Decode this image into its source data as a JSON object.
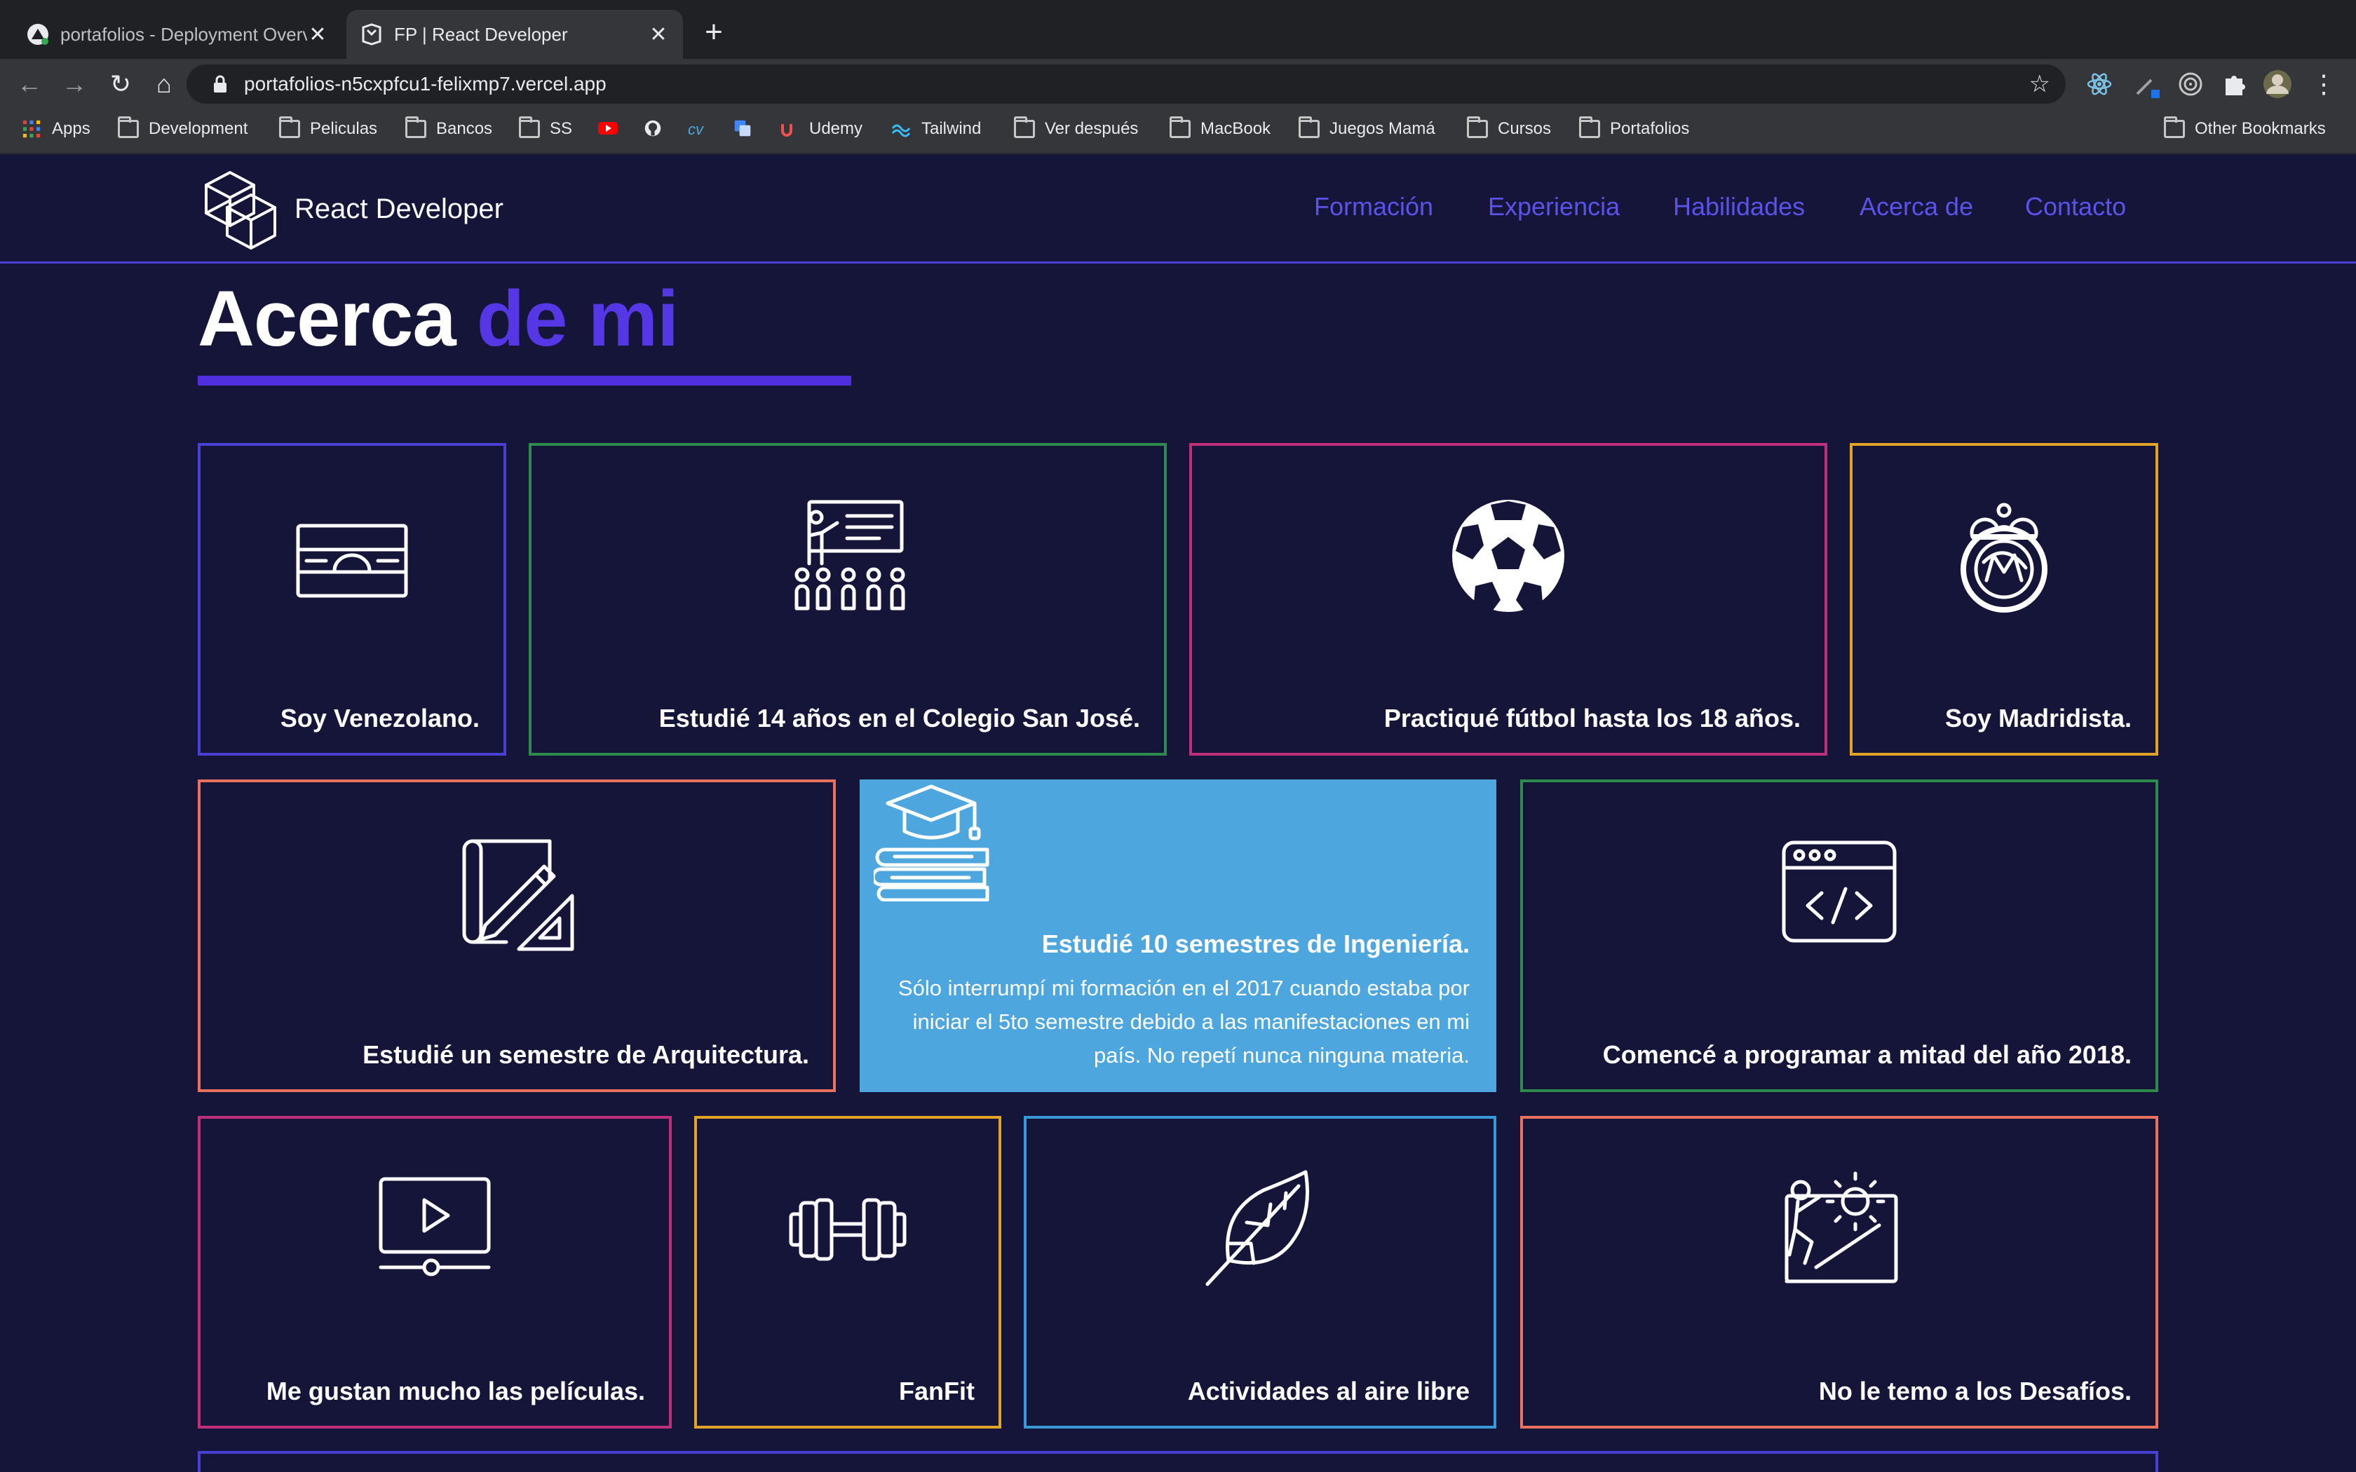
{
  "browser": {
    "tabs": [
      {
        "title": "portafolios - Deployment Overv"
      },
      {
        "title": "FP | React Developer"
      }
    ],
    "url": "portafolios-n5cxpfcu1-felixmp7.vercel.app",
    "bookmarks": [
      {
        "label": "Apps",
        "icon": "apps-grid-icon"
      },
      {
        "label": "Development",
        "icon": "folder-icon"
      },
      {
        "label": "Peliculas",
        "icon": "folder-icon"
      },
      {
        "label": "Bancos",
        "icon": "folder-icon"
      },
      {
        "label": "SS",
        "icon": "folder-icon"
      },
      {
        "label": "",
        "icon": "youtube-icon"
      },
      {
        "label": "",
        "icon": "github-icon"
      },
      {
        "label": "",
        "icon": "cv-icon"
      },
      {
        "label": "",
        "icon": "translate-icon"
      },
      {
        "label": "Udemy",
        "icon": "udemy-icon"
      },
      {
        "label": "Tailwind",
        "icon": "tailwind-icon"
      },
      {
        "label": "Ver después",
        "icon": "folder-icon"
      },
      {
        "label": "MacBook",
        "icon": "folder-icon"
      },
      {
        "label": "Juegos Mamá",
        "icon": "folder-icon"
      },
      {
        "label": "Cursos",
        "icon": "folder-icon"
      },
      {
        "label": "Portafolios",
        "icon": "folder-icon"
      }
    ],
    "other_bookmarks": "Other Bookmarks"
  },
  "site": {
    "brand": "React Developer",
    "nav": [
      "Formación",
      "Experiencia",
      "Habilidades",
      "Acerca de",
      "Contacto"
    ],
    "heading_main": "Acerca",
    "heading_accent": "de mi",
    "accent_color": "#5637e6"
  },
  "cards": {
    "venezuela": {
      "label": "Soy Venezolano.",
      "border": "#4a3fd4",
      "icon": "flag-icon"
    },
    "colegio": {
      "label": "Estudié 14 años en el Colegio San José.",
      "border": "#2f8a4e",
      "icon": "classroom-icon"
    },
    "futbol": {
      "label": "Practiqué fútbol hasta los 18 años.",
      "border": "#c0307a",
      "icon": "soccer-ball-icon"
    },
    "madrid": {
      "label": "Soy Madridista.",
      "border": "#e2a427",
      "icon": "real-madrid-crest-icon"
    },
    "arquitectura": {
      "label": "Estudié un semestre de Arquitectura.",
      "border": "#e8725e",
      "icon": "blueprint-icon"
    },
    "ingenieria": {
      "title": "Estudié 10 semestres de Ingeniería.",
      "description": "Sólo interrumpí mi formación en el 2017 cuando estaba por iniciar el 5to semestre debido a las manifestaciones en mi país. No repetí nunca ninguna materia.",
      "background": "#4ea6de",
      "icon": "graduation-books-icon"
    },
    "programar": {
      "label": "Comencé a programar a mitad del año 2018.",
      "border": "#2f8a4e",
      "icon": "code-window-icon"
    },
    "peliculas": {
      "label": "Me gustan mucho las películas.",
      "border": "#c0307a",
      "icon": "video-player-icon"
    },
    "fanfit": {
      "label": "FanFit",
      "border": "#e2a427",
      "icon": "dumbbell-icon"
    },
    "aire_libre": {
      "label": "Actividades al aire libre",
      "border": "#3a9ad9",
      "icon": "leaf-icon"
    },
    "desafios": {
      "label": "No le temo a los Desafíos.",
      "border": "#e8725e",
      "icon": "climbing-gear-icon"
    }
  }
}
